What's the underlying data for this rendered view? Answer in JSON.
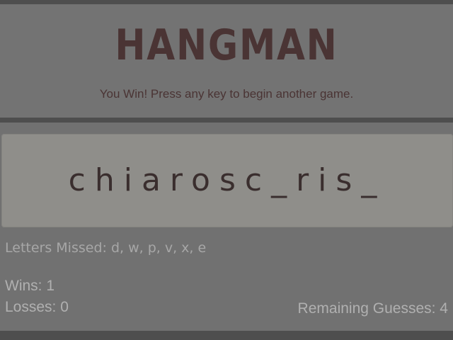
{
  "game": {
    "title": "HANGMAN",
    "message": "You Win! Press any key to begin another game.",
    "word_display": "chiarosc_ris_",
    "missed_text": "Letters Missed: d, w, p, v, x, e",
    "wins_text": "Wins: 1",
    "losses_text": "Losses: 0",
    "remaining_text": "Remaining Guesses: 4"
  },
  "colors": {
    "background": "#717171",
    "title": "#4a3434",
    "panel": "#8f8e8a",
    "word": "#3a2e2e",
    "stats": "#b0b0b0"
  }
}
